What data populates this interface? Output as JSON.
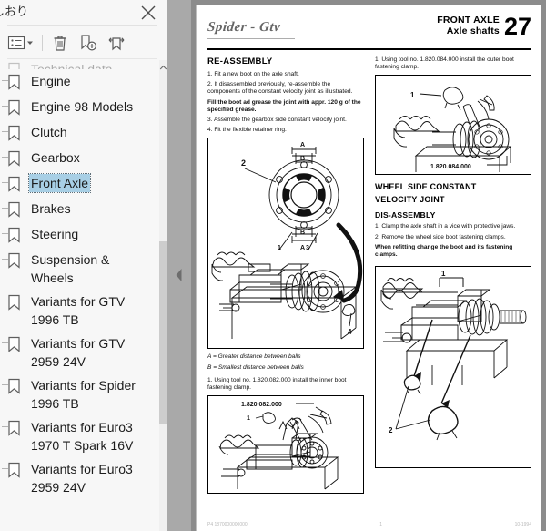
{
  "bookmark_panel": {
    "title": "しおり",
    "close_label": "×",
    "toolbar": {
      "options_label": "options-list",
      "delete_label": "delete-bookmark",
      "new_bookmark_label": "new-bookmark",
      "expand_label": "expand-current-bookmark"
    },
    "selection_color": "#a8cfe5",
    "items": [
      {
        "label": "Technical data",
        "partial": true,
        "selected": false
      },
      {
        "label": "Engine",
        "partial": false,
        "selected": false
      },
      {
        "label": "Engine 98 Models",
        "partial": false,
        "selected": false
      },
      {
        "label": "Clutch",
        "partial": false,
        "selected": false
      },
      {
        "label": "Gearbox",
        "partial": false,
        "selected": false
      },
      {
        "label": "Front Axle",
        "partial": false,
        "selected": true
      },
      {
        "label": "Brakes",
        "partial": false,
        "selected": false
      },
      {
        "label": "Steering",
        "partial": false,
        "selected": false
      },
      {
        "label": "Suspension & Wheels",
        "partial": false,
        "selected": false
      },
      {
        "label": "Variants for GTV 1996 TB",
        "partial": false,
        "selected": false
      },
      {
        "label": "Variants for GTV 2959 24V",
        "partial": false,
        "selected": false
      },
      {
        "label": "Variants for Spider 1996 TB",
        "partial": false,
        "selected": false
      },
      {
        "label": "Variants for Euro3 1970 T Spark 16V",
        "partial": false,
        "selected": false
      },
      {
        "label": "Variants for Euro3 2959 24V",
        "partial": false,
        "selected": false
      }
    ]
  },
  "document": {
    "header": {
      "brand": "Spider - Gtv",
      "section_title": "FRONT AXLE",
      "section_subtitle": "Axle shafts",
      "section_number": "27"
    },
    "left_column": {
      "heading": "RE-ASSEMBLY",
      "step1": "1.  Fit a new boot on the axle shaft.",
      "step2": "2.  If disassembled previously, re-assemble the components of the constant velocity joint as illustrated.",
      "bold_note": "Fill the boot ad grease the joint with appr. 120 g of the specified grease.",
      "step3": "3.  Assemble the gearbox side constant velocity joint.",
      "step4": "4.  Fit the flexible retainer ring.",
      "figure": {
        "callouts": [
          "1",
          "2",
          "3",
          "4"
        ],
        "dim_labels": [
          "A",
          "B",
          "B",
          "A"
        ]
      },
      "legend_a": "A = Greater distance between balls",
      "legend_b": "B = Smallest distance between balls",
      "tool_step": "1.  Using tool no. 1.820.082.000 install the inner boot fastening clamp.",
      "figure2": {
        "tool_code": "1.820.082.000",
        "callouts": [
          "1"
        ]
      }
    },
    "right_column": {
      "tool_step": "1.  Using tool no. 1.820.084.000 install the outer boot fastening clamp.",
      "figure1": {
        "tool_code": "1.820.084.000",
        "callouts": [
          "1"
        ]
      },
      "heading_line1": "WHEEL SIDE CONSTANT",
      "heading_line2": "VELOCITY JOINT",
      "subheading": "DIS-ASSEMBLY",
      "step1": "1.  Clamp the axle shaft in a vice with protective jaws.",
      "step2": "2.  Remove the wheel side boot fastening clamps.",
      "bold_note": "When refitting change the boot and its fastening clamps.",
      "figure2": {
        "callouts": [
          "1",
          "2"
        ]
      }
    },
    "footer": {
      "left": "P4 1870000000000",
      "center": "1",
      "right": "10-1994"
    }
  }
}
